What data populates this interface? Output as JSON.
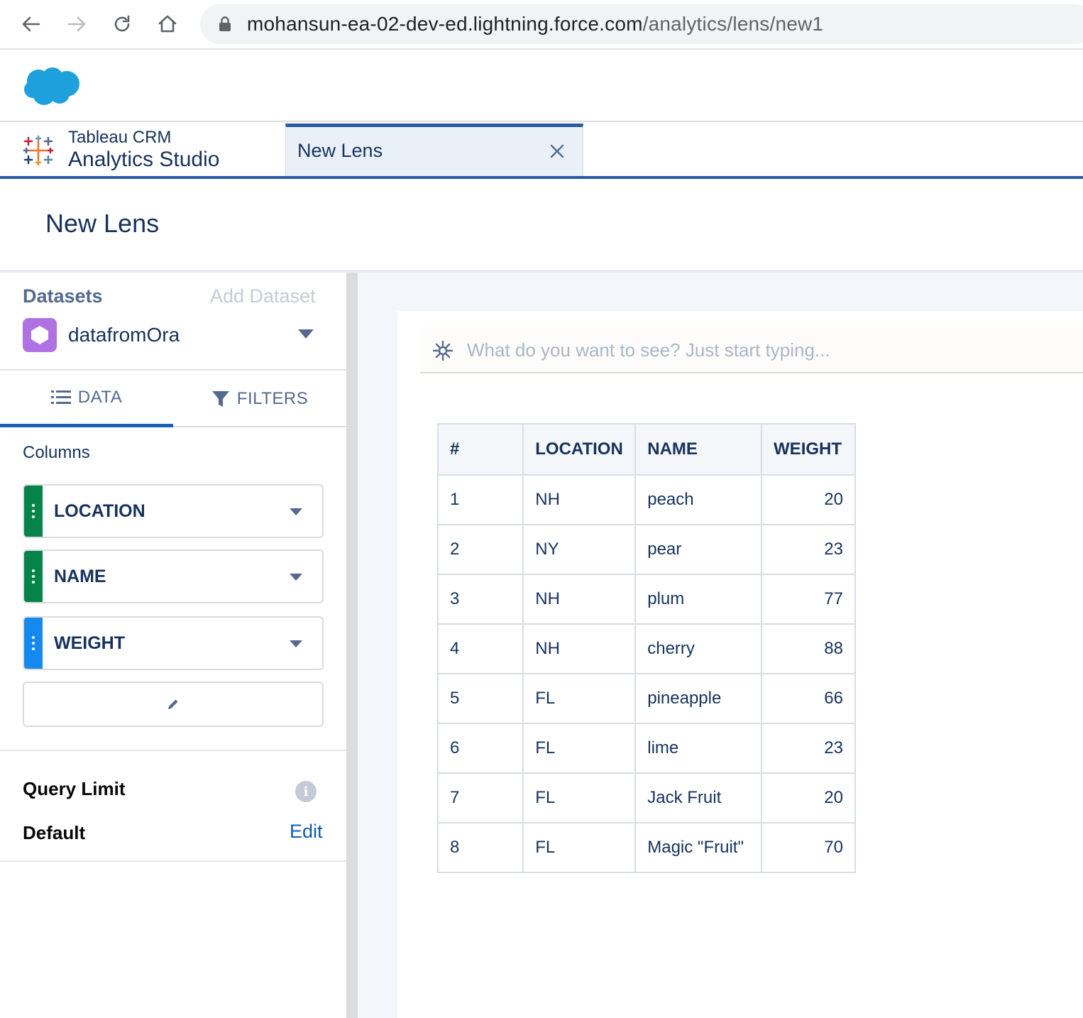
{
  "browser": {
    "url_host": "mohansun-ea-02-dev-ed.lightning.force.com",
    "url_path": "/analytics/lens/new1"
  },
  "app": {
    "name_line1": "Tableau CRM",
    "name_line2": "Analytics Studio",
    "tab_label": "New Lens"
  },
  "page": {
    "title": "New Lens"
  },
  "left_panel": {
    "datasets_label": "Datasets",
    "add_dataset": "Add Dataset",
    "dataset_name": "datafromOra",
    "tab_data": "DATA",
    "tab_filters": "FILTERS",
    "columns_label": "Columns",
    "columns": [
      {
        "label": "LOCATION",
        "color": "#04844b"
      },
      {
        "label": "NAME",
        "color": "#04844b"
      },
      {
        "label": "WEIGHT",
        "color": "#1589ee"
      }
    ],
    "query_limit_label": "Query Limit",
    "query_limit_value": "Default",
    "query_limit_edit": "Edit"
  },
  "query_bar": {
    "placeholder": "What do you want to see? Just start typing..."
  },
  "table": {
    "headers": [
      "#",
      "LOCATION",
      "NAME",
      "WEIGHT"
    ],
    "rows": [
      [
        "1",
        "NH",
        "peach",
        "20"
      ],
      [
        "2",
        "NY",
        "pear",
        "23"
      ],
      [
        "3",
        "NH",
        "plum",
        "77"
      ],
      [
        "4",
        "NH",
        "cherry",
        "88"
      ],
      [
        "5",
        "FL",
        "pineapple",
        "66"
      ],
      [
        "6",
        "FL",
        "lime",
        "23"
      ],
      [
        "7",
        "FL",
        "Jack Fruit",
        "20"
      ],
      [
        "8",
        "FL",
        "Magic \"Fruit\"",
        "70"
      ]
    ]
  }
}
